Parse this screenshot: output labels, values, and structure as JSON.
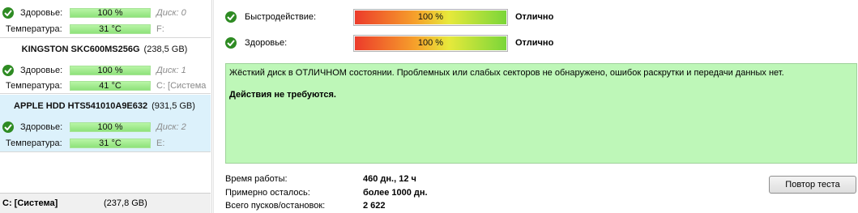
{
  "disks": [
    {
      "title": "",
      "size": "",
      "health_label": "Здоровье:",
      "health_value": "100 %",
      "health_extra": "Диск: 0",
      "temp_label": "Температура:",
      "temp_value": "31 °C",
      "temp_extra": "F:"
    },
    {
      "title": "KINGSTON SKC600MS256G",
      "size": "(238,5 GB)",
      "health_label": "Здоровье:",
      "health_value": "100 %",
      "health_extra": "Диск: 1",
      "temp_label": "Температура:",
      "temp_value": "41 °C",
      "temp_extra": "C: [Система"
    },
    {
      "title": "APPLE HDD HTS541010A9E632",
      "size": "(931,5 GB)",
      "health_label": "Здоровье:",
      "health_value": "100 %",
      "health_extra": "Диск: 2",
      "temp_label": "Температура:",
      "temp_value": "31 °C",
      "temp_extra": "E:"
    }
  ],
  "partition": {
    "name": "C: [Система]",
    "size": "(237,8 GB)"
  },
  "metrics": [
    {
      "label": "Быстродействие:",
      "bar_text": "100 %",
      "percent": 100,
      "verdict": "Отлично"
    },
    {
      "label": "Здоровье:",
      "bar_text": "100 %",
      "percent": 100,
      "verdict": "Отлично"
    }
  ],
  "status": {
    "message": "Жёсткий диск в ОТЛИЧНОМ состоянии. Проблемных или слабых секторов не обнаружено, ошибок раскрутки и передачи данных нет.",
    "action": "Действия не требуются."
  },
  "info": [
    {
      "label": "Время работы:",
      "value": "460 дн., 12 ч"
    },
    {
      "label": "Примерно осталось:",
      "value": "более 1000 дн."
    },
    {
      "label": "Всего пусков/остановок:",
      "value": "2 622"
    }
  ],
  "retest_button": "Повтор теста",
  "colors": {
    "ok_green": "#2e8b23",
    "status_bg": "#bef7b8",
    "selected_bg": "#dcf1fb"
  }
}
